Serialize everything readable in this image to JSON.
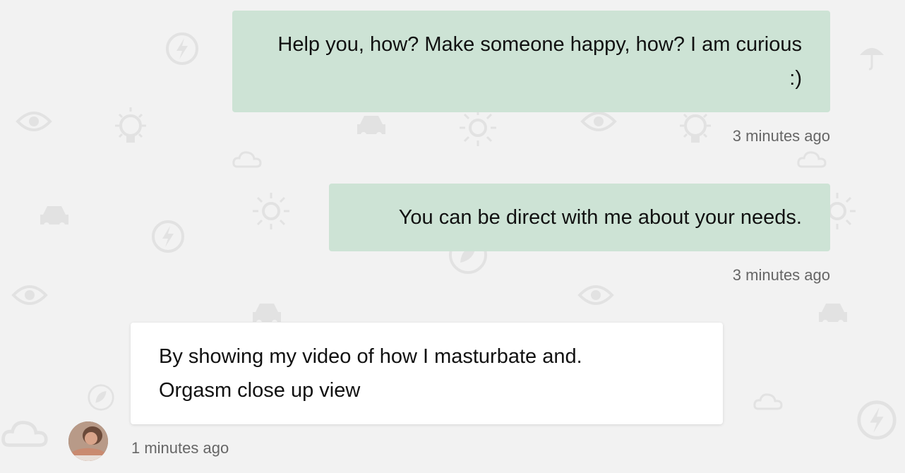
{
  "messages": [
    {
      "direction": "sent",
      "text": "Help you, how? Make someone happy, how? I am curious :)",
      "timestamp": "3 minutes ago"
    },
    {
      "direction": "sent",
      "text": "You can be direct with me about your needs.",
      "timestamp": "3 minutes ago"
    },
    {
      "direction": "received",
      "text": "By showing my video of how I masturbate and. Orgasm close up view",
      "timestamp": "1 minutes ago",
      "avatar_icon": "user-avatar-photo"
    }
  ],
  "colors": {
    "background": "#f2f2f2",
    "sent_bubble": "#cde3d5",
    "received_bubble": "#ffffff",
    "timestamp": "#666666",
    "pattern": "#e2e2e2"
  },
  "background_icons": [
    "eye-icon",
    "lightbulb-icon",
    "car-icon",
    "sun-icon",
    "cloud-icon",
    "lightning-icon",
    "umbrella-icon",
    "leaf-icon"
  ]
}
